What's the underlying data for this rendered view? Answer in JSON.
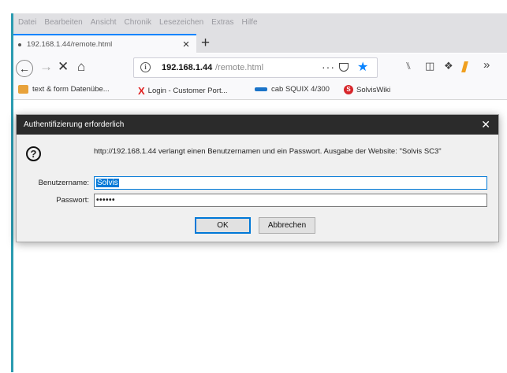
{
  "menubar": {
    "items": [
      "Datei",
      "Bearbeiten",
      "Ansicht",
      "Chronik",
      "Lesezeichen",
      "Extras",
      "Hilfe"
    ]
  },
  "tab": {
    "title": "192.168.1.44/remote.html",
    "close_glyph": "×",
    "new_tab_glyph": "+"
  },
  "navbar": {
    "back_glyph": "←",
    "forward_glyph": "→",
    "stop_glyph": "✕",
    "home_glyph": "⌂",
    "url_host": "192.168.1.44",
    "url_path": "/remote.html",
    "more_glyph": "···",
    "star_glyph": "★",
    "library_glyph": "⑊",
    "sidebar_glyph": "◫",
    "extension_glyph": "❖",
    "overflow_glyph": "»"
  },
  "bookmarks": [
    {
      "label": "text & form Datenübe..."
    },
    {
      "label": "Login - Customer Port..."
    },
    {
      "label": "cab SQUIX 4/300"
    },
    {
      "label": "SolvisWiki"
    }
  ],
  "dialog": {
    "title": "Authentifizierung erforderlich",
    "close_glyph": "✕",
    "message": "http://192.168.1.44 verlangt einen Benutzernamen und ein Passwort. Ausgabe der Website: \"Solvis SC3\"",
    "username_label": "Benutzername:",
    "username_value": "Solvis",
    "password_label": "Passwort:",
    "password_value": "••••••",
    "ok_label": "OK",
    "cancel_label": "Abbrechen"
  },
  "colors": {
    "accent": "#0a84ff",
    "window_border": "#2a9bb0",
    "dialog_titlebar": "#2b2b2b",
    "selection": "#0078d7"
  }
}
